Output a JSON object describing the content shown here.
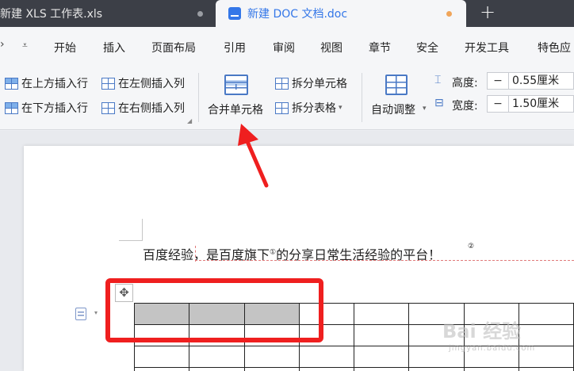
{
  "tabs": [
    {
      "title": "新建 XLS 工作表.xls"
    },
    {
      "title": "新建 DOC 文档.doc"
    }
  ],
  "add_tab_label": "+",
  "menu": {
    "icons": [
      "下拉箭头"
    ],
    "items": [
      "开始",
      "插入",
      "页面布局",
      "引用",
      "审阅",
      "视图",
      "章节",
      "安全",
      "开发工具",
      "特色应"
    ]
  },
  "ribbon": {
    "insert_above": "在上方插入行",
    "insert_below": "在下方插入行",
    "insert_left": "在左侧插入列",
    "insert_right": "在右侧插入列",
    "merge_cells": "合并单元格",
    "split_cells": "拆分单元格",
    "split_table": "拆分表格",
    "auto_fit": "自动调整",
    "height_label": "高度:",
    "height_value": "0.55厘米",
    "width_label": "宽度:",
    "width_value": "1.50厘米",
    "minus": "−"
  },
  "document": {
    "paragraph_a": "百度经验",
    "paragraph_b": "，是百度旗下",
    "footnote_1": "①",
    "paragraph_c": "的分享日常生活经验的平台！",
    "footnote_2": "②",
    "move_handle": "✥",
    "table": {
      "rows": 4,
      "cols": 8,
      "selected": [
        [
          0,
          0
        ],
        [
          0,
          1
        ],
        [
          0,
          2
        ]
      ]
    }
  },
  "watermark": {
    "main": "Bai   经验",
    "sub": "jingyan.baidu.com"
  },
  "colors": {
    "accent": "#3477e8",
    "annotation": "#ef1f1f",
    "selection": "#c4c4c4"
  }
}
